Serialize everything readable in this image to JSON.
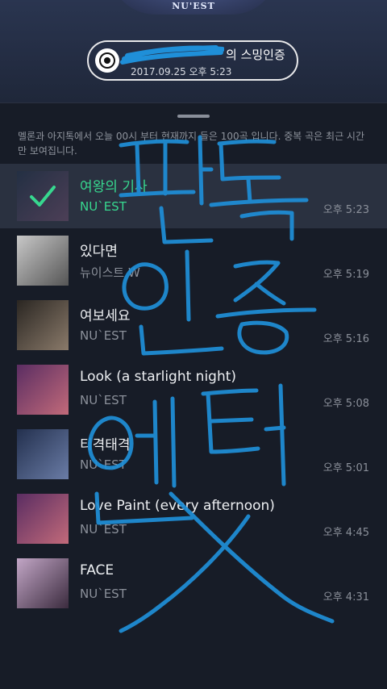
{
  "header": {
    "album_logo": "NU'EST",
    "pill_title": "의 스밍인증",
    "pill_date": "2017.09.25 오후 5:23"
  },
  "sheet": {
    "notice": "멜론과 아지톡에서 오늘 00시 부터 현재까지 들은 100곡 입니다. 중복 곡은 최근 시간만 보여집니다."
  },
  "tracks": [
    {
      "title": "여왕의 기사",
      "artist": "NU`EST",
      "time": "오후 5:23",
      "selected": true,
      "art_colors": [
        "#2c3a52",
        "#6b5270"
      ]
    },
    {
      "title": "있다면",
      "artist": "뉴이스트 W",
      "time": "오후 5:19",
      "selected": false,
      "art_colors": [
        "#c8c8c8",
        "#555555"
      ]
    },
    {
      "title": "여보세요",
      "artist": "NU`EST",
      "time": "오후 5:16",
      "selected": false,
      "art_colors": [
        "#2a2622",
        "#8a7a6a"
      ]
    },
    {
      "title": "Look (a starlight night)",
      "artist": "NU`EST",
      "time": "오후 5:08",
      "selected": false,
      "art_colors": [
        "#5a2d62",
        "#c26a7a"
      ]
    },
    {
      "title": "티격태격",
      "artist": "NU`EST",
      "time": "오후 5:01",
      "selected": false,
      "art_colors": [
        "#23304e",
        "#6a7ca6"
      ]
    },
    {
      "title": "Love Paint (every afternoon)",
      "artist": "NU`EST",
      "time": "오후 4:45",
      "selected": false,
      "art_colors": [
        "#5a2d62",
        "#c26a7a"
      ]
    },
    {
      "title": "FACE",
      "artist": "NU`EST",
      "time": "오후 4:31",
      "selected": false,
      "art_colors": [
        "#c2a6c6",
        "#3b2b3e"
      ]
    }
  ],
  "overlay": {
    "scribble_color": "#1f8fd8",
    "scribble_text": "팬독 인증 엔터 X"
  }
}
